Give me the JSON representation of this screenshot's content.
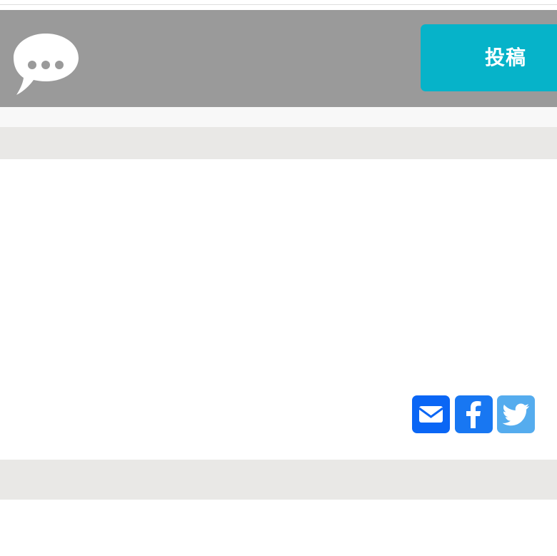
{
  "header": {
    "post_button_label": "投稿",
    "chat_icon": "speech-bubble-ellipsis-icon"
  },
  "share": {
    "buttons": [
      {
        "icon": "mail-icon",
        "color": "#0a66f5"
      },
      {
        "icon": "facebook-icon",
        "color": "#1877f2"
      },
      {
        "icon": "twitter-icon",
        "color": "#55acee"
      }
    ]
  },
  "colors": {
    "header_background": "#9a9a9a",
    "post_button_background": "#06b3c9",
    "strip_gray": "#e9e8e6"
  }
}
